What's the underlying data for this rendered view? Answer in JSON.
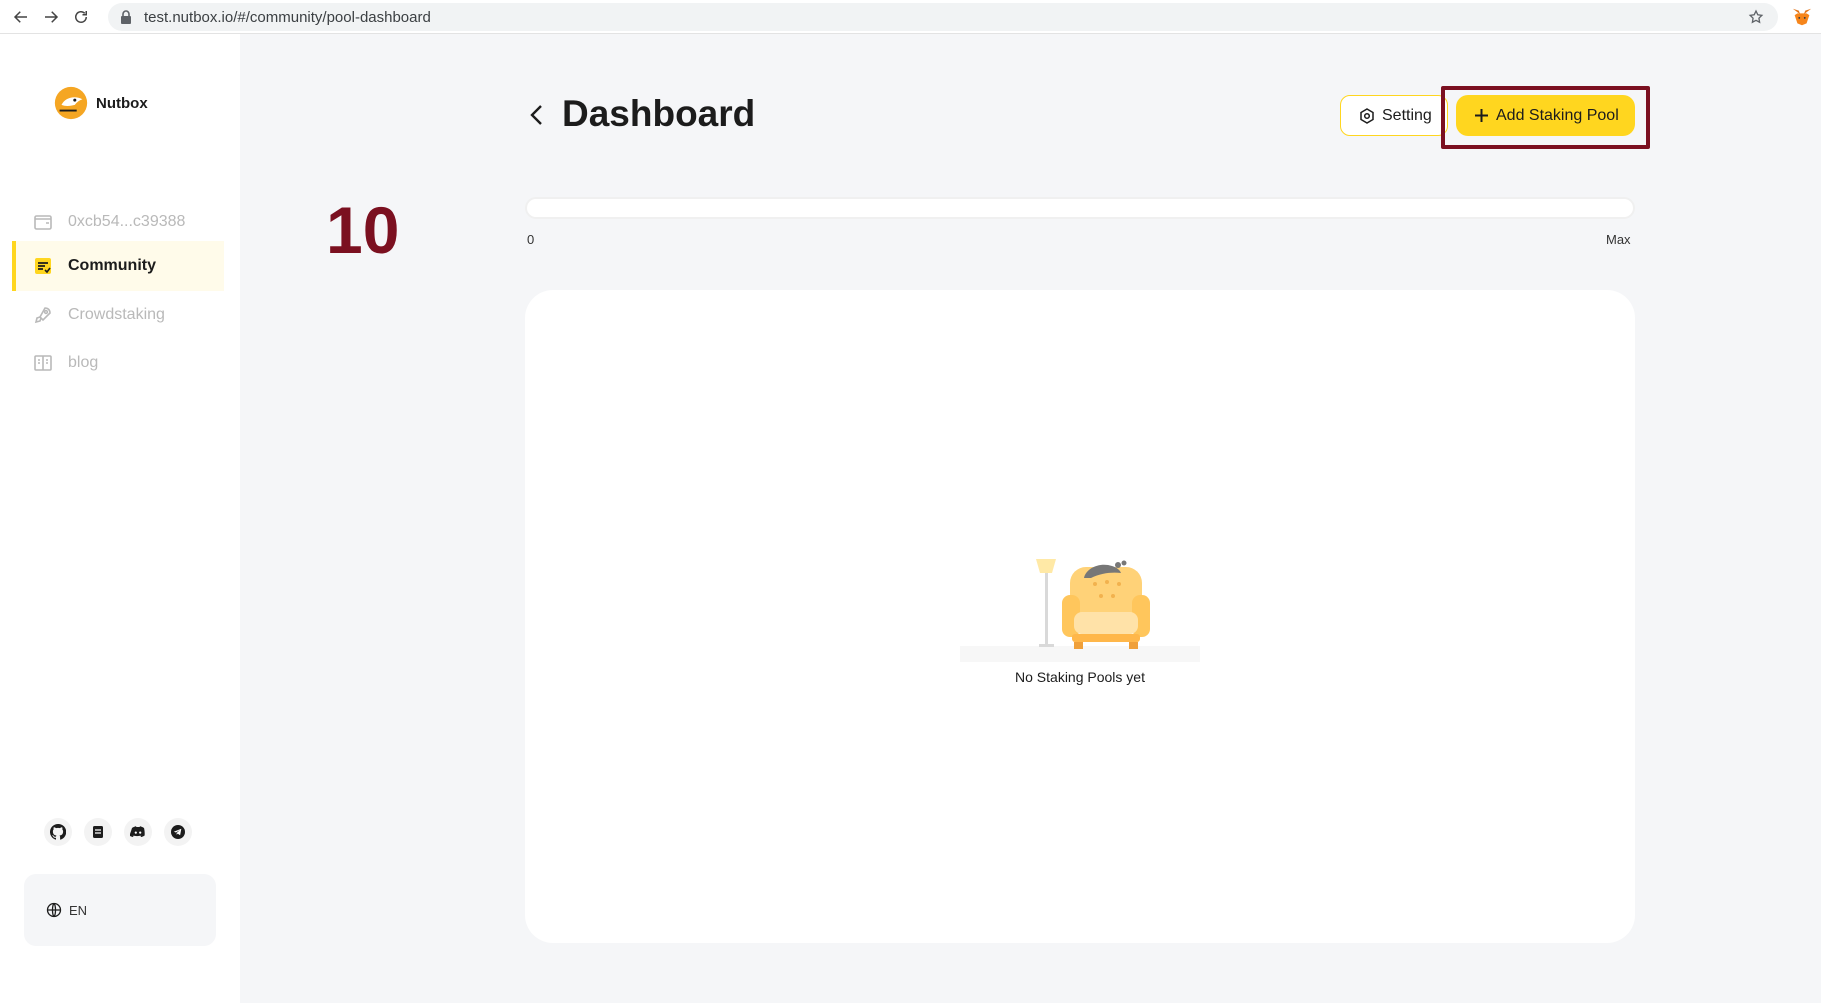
{
  "browser": {
    "url": "test.nutbox.io/#/community/pool-dashboard"
  },
  "sidebar": {
    "logo_text": "Nutbox",
    "items": [
      {
        "label": "0xcb54...c39388",
        "icon": "wallet-icon",
        "active": false
      },
      {
        "label": "Community",
        "icon": "community-icon",
        "active": true
      },
      {
        "label": "Crowdstaking",
        "icon": "rocket-icon",
        "active": false
      },
      {
        "label": "blog",
        "icon": "book-icon",
        "active": false
      }
    ],
    "social": [
      "github-icon",
      "docs-icon",
      "discord-icon",
      "telegram-icon"
    ],
    "language": "EN"
  },
  "main": {
    "title": "Dashboard",
    "setting_label": "Setting",
    "add_pool_label": "Add Staking Pool",
    "progress": {
      "min_label": "0",
      "max_label": "Max",
      "value": 0
    },
    "empty_text": "No Staking Pools yet"
  },
  "annotation": {
    "step_number": "10"
  },
  "colors": {
    "accent": "#ffd61f",
    "annotation": "#7b1020"
  }
}
